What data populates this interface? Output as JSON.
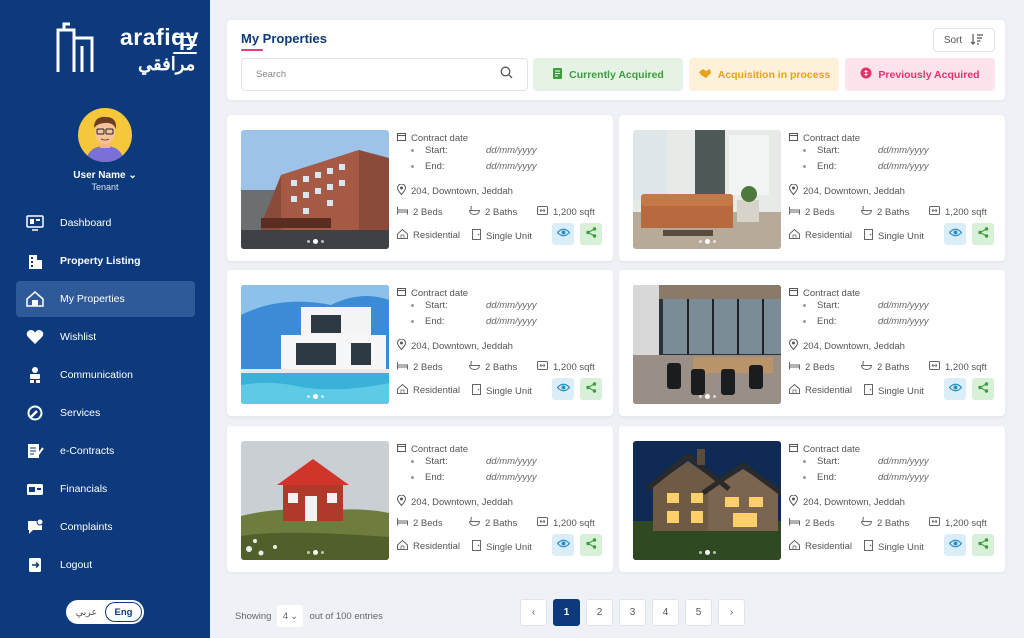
{
  "brand": {
    "name": "arafiqy",
    "name_ar": "مرافقي"
  },
  "user": {
    "name": "User Name",
    "role": "Tenant"
  },
  "nav": [
    {
      "label": "Dashboard",
      "icon": "dashboard-icon"
    },
    {
      "label": "Property Listing",
      "icon": "building-icon"
    },
    {
      "label": "My Properties",
      "icon": "house-icon"
    },
    {
      "label": "Wishlist",
      "icon": "heart-icon"
    },
    {
      "label": "Communication",
      "icon": "people-icon"
    },
    {
      "label": "Services",
      "icon": "wrench-icon"
    },
    {
      "label": "e-Contracts",
      "icon": "contract-icon"
    },
    {
      "label": "Financials",
      "icon": "wallet-icon"
    },
    {
      "label": "Complaints",
      "icon": "chat-icon"
    },
    {
      "label": "Logout",
      "icon": "logout-icon"
    }
  ],
  "language": {
    "arabic": "عربي",
    "english": "Eng"
  },
  "page": {
    "title": "My Properties",
    "sort_label": "Sort"
  },
  "search": {
    "placeholder": "Search"
  },
  "filters": [
    {
      "label": "Currently Acquired",
      "color": "#3d9c3f"
    },
    {
      "label": "Acquisition in process",
      "color": "#e9a21c"
    },
    {
      "label": "Previously Acquired",
      "color": "#e2336a"
    }
  ],
  "card_labels": {
    "contract": "Contract date",
    "start": "Start:",
    "end": "End:"
  },
  "properties": [
    {
      "start": "dd/mm/yyyy",
      "end": "dd/mm/yyyy",
      "location": "204, Downtown, Jeddah",
      "beds": "2 Beds",
      "baths": "2 Baths",
      "area": "1,200 sqft",
      "type": "Residential",
      "unit": "Single Unit"
    },
    {
      "start": "dd/mm/yyyy",
      "end": "dd/mm/yyyy",
      "location": "204, Downtown, Jeddah",
      "beds": "2 Beds",
      "baths": "2 Baths",
      "area": "1,200 sqft",
      "type": "Residential",
      "unit": "Single Unit"
    },
    {
      "start": "dd/mm/yyyy",
      "end": "dd/mm/yyyy",
      "location": "204, Downtown, Jeddah",
      "beds": "2 Beds",
      "baths": "2 Baths",
      "area": "1,200 sqft",
      "type": "Residential",
      "unit": "Single Unit"
    },
    {
      "start": "dd/mm/yyyy",
      "end": "dd/mm/yyyy",
      "location": "204, Downtown, Jeddah",
      "beds": "2 Beds",
      "baths": "2 Baths",
      "area": "1,200 sqft",
      "type": "Residential",
      "unit": "Single Unit"
    },
    {
      "start": "dd/mm/yyyy",
      "end": "dd/mm/yyyy",
      "location": "204, Downtown, Jeddah",
      "beds": "2 Beds",
      "baths": "2 Baths",
      "area": "1,200 sqft",
      "type": "Residential",
      "unit": "Single Unit"
    },
    {
      "start": "dd/mm/yyyy",
      "end": "dd/mm/yyyy",
      "location": "204, Downtown, Jeddah",
      "beds": "2 Beds",
      "baths": "2 Baths",
      "area": "1,200 sqft",
      "type": "Residential",
      "unit": "Single Unit"
    }
  ],
  "pagination": {
    "showing": "Showing",
    "per_page": "4",
    "of_text": "out of 100 entries",
    "pages": [
      "1",
      "2",
      "3",
      "4",
      "5"
    ],
    "prev": "‹",
    "next": "›"
  },
  "colors": {
    "primary": "#0c3a7c",
    "accent": "#e83b6f"
  }
}
